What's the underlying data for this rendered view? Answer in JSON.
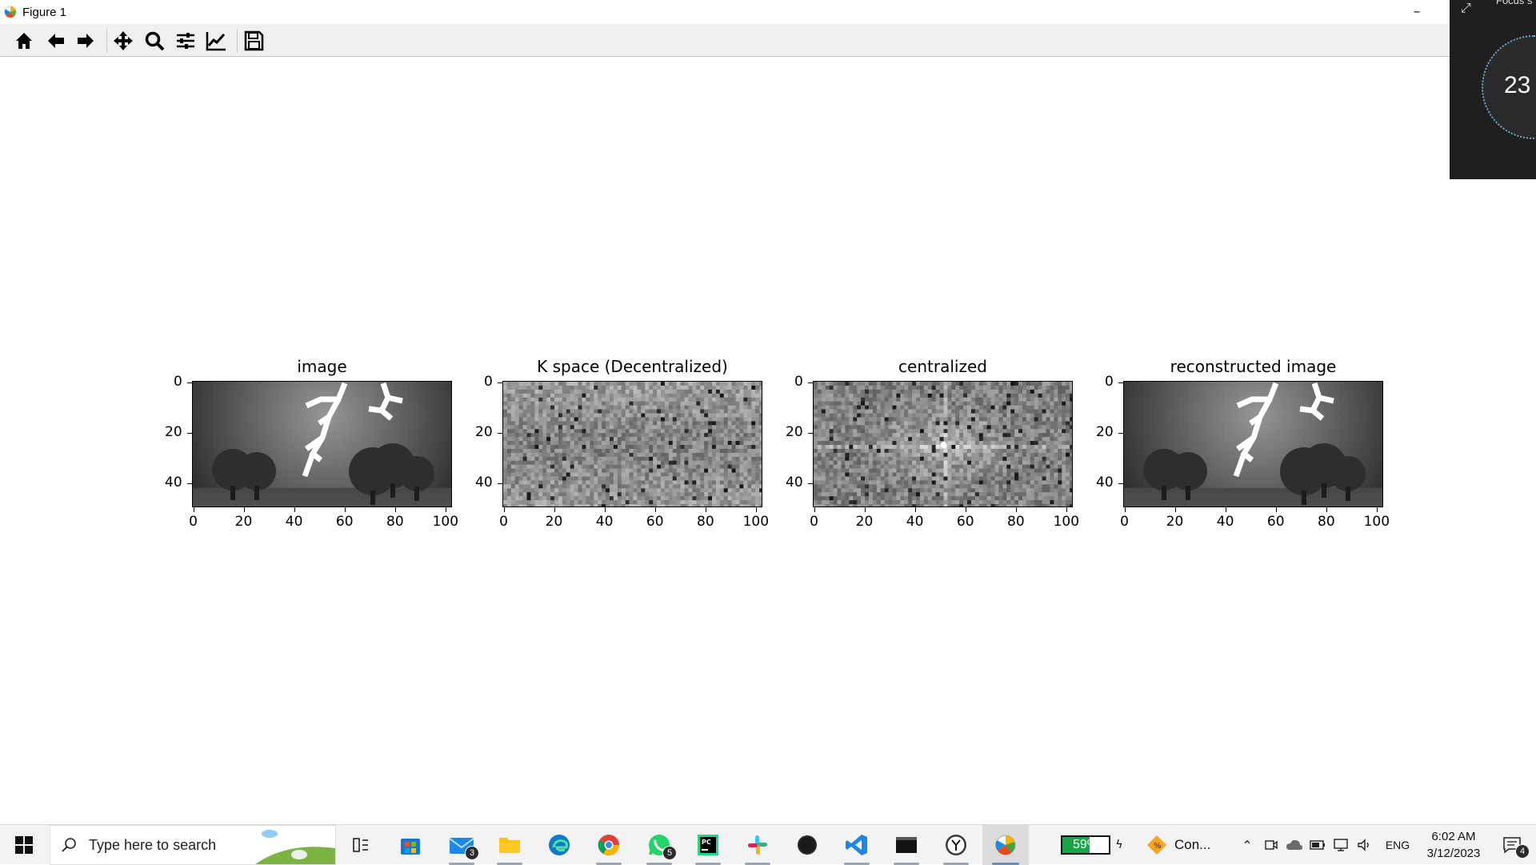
{
  "window": {
    "title": "Figure 1",
    "minimize_glyph": "–"
  },
  "toolbar": {
    "buttons": [
      {
        "name": "home-icon"
      },
      {
        "name": "back-arrow-icon"
      },
      {
        "name": "forward-arrow-icon"
      },
      {
        "name": "pan-move-icon"
      },
      {
        "name": "zoom-magnifier-icon"
      },
      {
        "name": "configure-subplots-icon"
      },
      {
        "name": "edit-axis-icon"
      },
      {
        "name": "save-disk-icon"
      }
    ]
  },
  "figure": {
    "subplots": [
      {
        "title": "image",
        "yticks": [
          "0",
          "20",
          "40"
        ],
        "xticks": [
          "0",
          "20",
          "40",
          "60",
          "80",
          "100"
        ],
        "kind": "scene"
      },
      {
        "title": "K space (Decentralized)",
        "yticks": [
          "0",
          "20",
          "40"
        ],
        "xticks": [
          "0",
          "20",
          "40",
          "60",
          "80",
          "100"
        ],
        "kind": "noise"
      },
      {
        "title": "centralized",
        "yticks": [
          "0",
          "20",
          "40"
        ],
        "xticks": [
          "0",
          "20",
          "40",
          "60",
          "80",
          "100"
        ],
        "kind": "centered"
      },
      {
        "title": "reconstructed image",
        "yticks": [
          "0",
          "20",
          "40"
        ],
        "xticks": [
          "0",
          "20",
          "40",
          "60",
          "80",
          "100"
        ],
        "kind": "scene"
      }
    ]
  },
  "focus_widget": {
    "title": "Focus s",
    "timer": "23 m"
  },
  "taskbar": {
    "search_placeholder": "Type here to search",
    "mail_badge": "3",
    "whatsapp_badge": "5",
    "battery_percent": "59%",
    "connection_label": "Con...",
    "language": "ENG",
    "time": "6:02 AM",
    "date": "3/12/2023",
    "notifications_badge": "4"
  }
}
